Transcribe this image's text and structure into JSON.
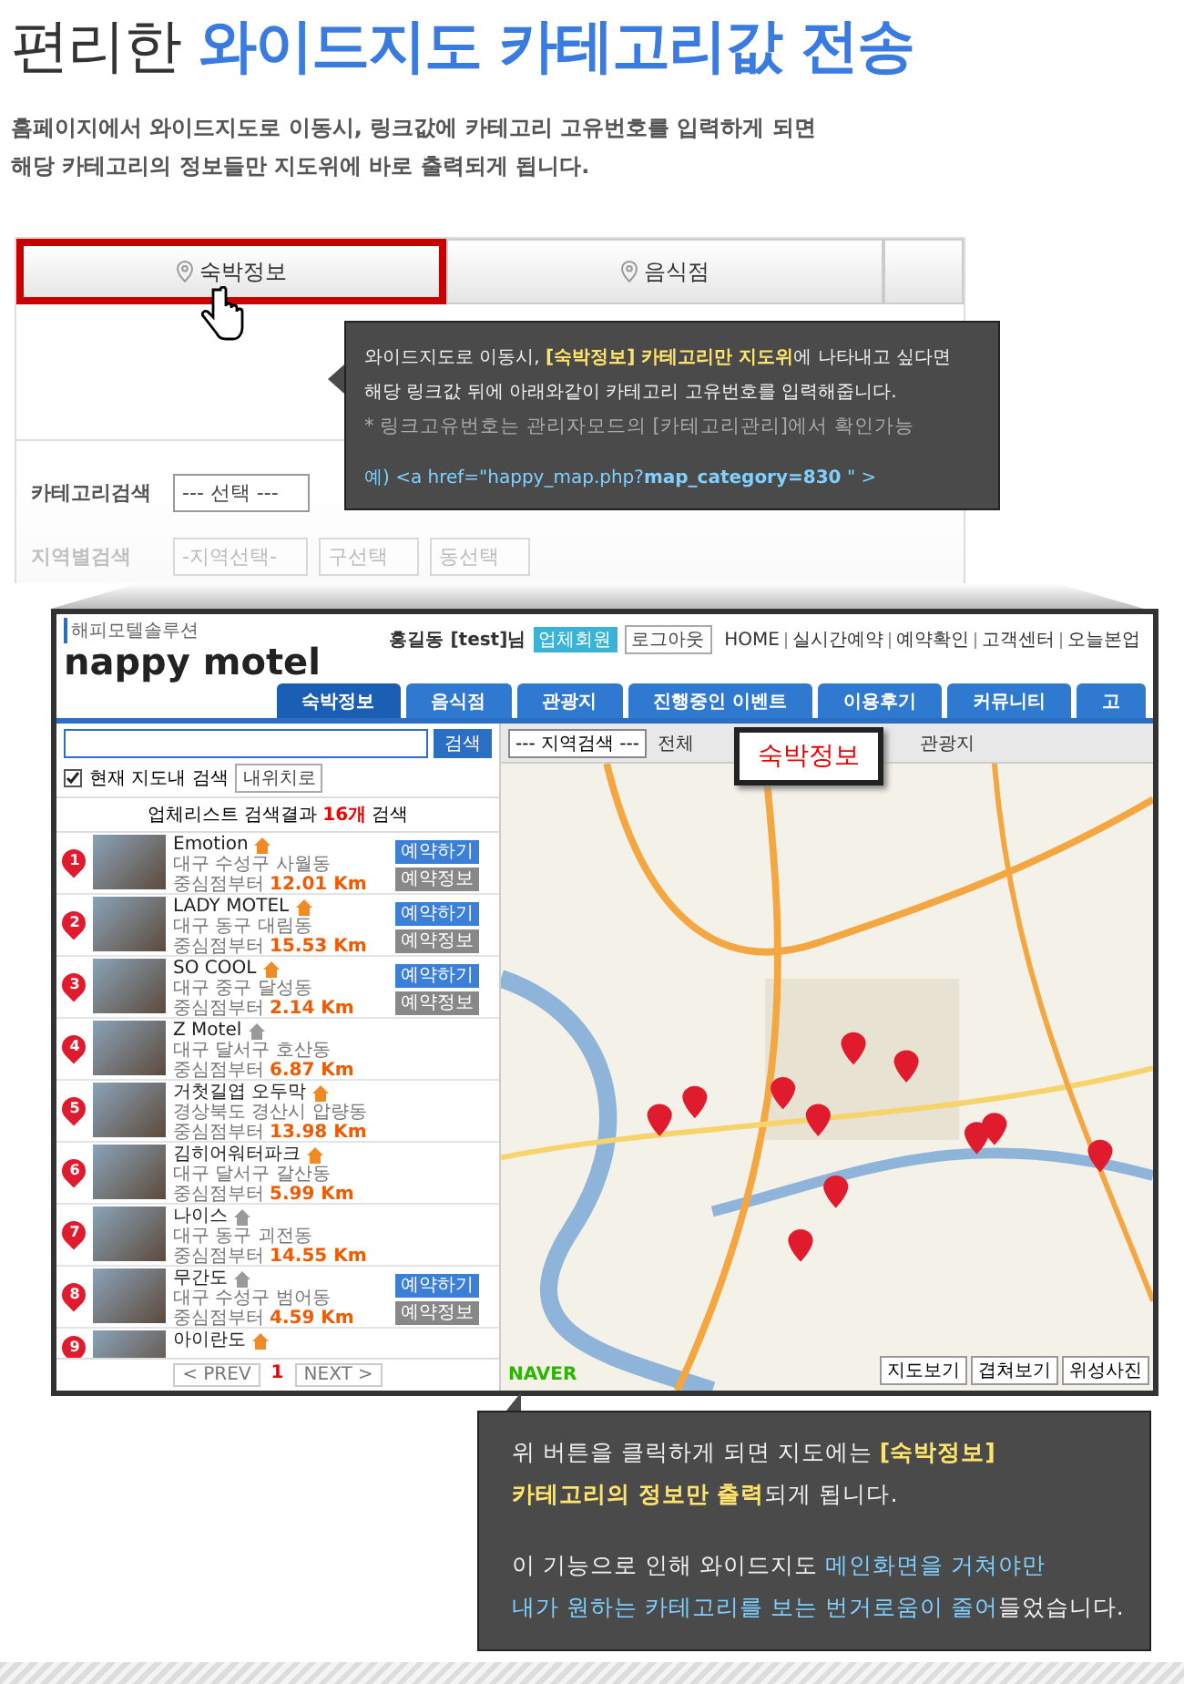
{
  "heading": {
    "plain": "편리한",
    "accent": "와이드지도 카테고리값 전송"
  },
  "intro": [
    "홈페이지에서 와이드지도로 이동시, 링크값에 카테고리 고유번호를 입력하게 되면",
    "해당 카테고리의 정보들만 지도위에 바로 출력되게 됩니다."
  ],
  "demo_panel": {
    "tabs": [
      {
        "label": "숙박정보",
        "selected": true
      },
      {
        "label": "음식점",
        "selected": false
      }
    ],
    "search_rows": [
      {
        "label": "카테고리검색",
        "selects": [
          "--- 선택 ---"
        ]
      },
      {
        "label": "지역별검색",
        "selects": [
          "-지역선택-",
          "구선택",
          "동선택"
        ]
      }
    ]
  },
  "top_callout": {
    "lines": [
      [
        {
          "text": "와이드지도로 이동시, ",
          "kind": "plain"
        },
        {
          "text": "[숙박정보] 카테고리만 지도위",
          "kind": "yellow"
        },
        {
          "text": "에 나타내고 싶다면",
          "kind": "plain"
        }
      ],
      [
        {
          "text": "해당 링크값 뒤에 아래와같이 카테고리 고유번호를 입력해줍니다.",
          "kind": "plain"
        }
      ]
    ],
    "note": "* 링크고유번호는 관리자모드의 [카테고리관리]에서 확인가능",
    "code": [
      {
        "text": "예) <a href=\"happy_map.php?",
        "kind": "cyan"
      },
      {
        "text": "map_category=830",
        "kind": "cyanbold"
      },
      {
        "text": " \" >",
        "kind": "cyan"
      }
    ]
  },
  "screenshot": {
    "logo_caption": "해피모텔솔루션",
    "logo": "nappy motel",
    "user": "홍길동 [test]님",
    "member_badge": "업체회원",
    "logout": "로그아웃",
    "top_links": [
      "HOME",
      "실시간예약",
      "예약확인",
      "고객센터",
      "오늘본업"
    ],
    "nav": [
      {
        "label": "숙박정보",
        "selected": true
      },
      {
        "label": "음식점",
        "selected": false
      },
      {
        "label": "관광지",
        "selected": false
      },
      {
        "label": "진행중인 이벤트",
        "selected": false
      },
      {
        "label": "이용후기",
        "selected": false
      },
      {
        "label": "커뮤니티",
        "selected": false
      },
      {
        "label": "고",
        "selected": false
      }
    ],
    "search_button": "검색",
    "in_map_search": {
      "label": "현재 지도내 검색",
      "checked": true
    },
    "my_location": "내위치로",
    "list_header": {
      "before": "업체리스트 검색결과",
      "count": "16개",
      "after": "검색"
    },
    "listings": [
      {
        "pin": "1",
        "name": "Emotion",
        "color": "#f08a24",
        "address": "대구 수성구 사월동",
        "distance_label": "중심점부터",
        "distance": "12.01 Km",
        "buttons": [
          "예약하기",
          "예약정보"
        ]
      },
      {
        "pin": "2",
        "name": "LADY MOTEL",
        "color": "#f08a24",
        "address": "대구 동구 대림동",
        "distance_label": "중심점부터",
        "distance": "15.53 Km",
        "buttons": [
          "예약하기",
          "예약정보"
        ]
      },
      {
        "pin": "3",
        "name": "SO COOL",
        "color": "#f08a24",
        "address": "대구 중구 달성동",
        "distance_label": "중심점부터",
        "distance": "2.14 Km",
        "buttons": [
          "예약하기",
          "예약정보"
        ]
      },
      {
        "pin": "4",
        "name": "Z Motel",
        "color": "#9a9a9a",
        "address": "대구 달서구 호산동",
        "distance_label": "중심점부터",
        "distance": "6.87 Km"
      },
      {
        "pin": "5",
        "name": "거첫길엽 오두막",
        "color": "#f08a24",
        "address": "경상북도 경산시 압량동",
        "distance_label": "중심점부터",
        "distance": "13.98 Km"
      },
      {
        "pin": "6",
        "name": "김히어워터파크",
        "color": "#f08a24",
        "address": "대구 달서구 갈산동",
        "distance_label": "중심점부터",
        "distance": "5.99 Km"
      },
      {
        "pin": "7",
        "name": "나이스",
        "color": "#9a9a9a",
        "address": "대구 동구 괴전동",
        "distance_label": "중심점부터",
        "distance": "14.55 Km"
      },
      {
        "pin": "8",
        "name": "무간도",
        "color": "#9a9a9a",
        "address": "대구 수성구 범어동",
        "distance_label": "중심점부터",
        "distance": "4.59 Km",
        "buttons": [
          "예약하기",
          "예약정보"
        ]
      },
      {
        "pin": "9",
        "name": "아이란도",
        "color": "#f08a24"
      }
    ],
    "pagination": {
      "prev": "< PREV",
      "page": "1",
      "next": "NEXT >"
    },
    "map_toolbar": {
      "region_select": "--- 지역검색 ---",
      "items": [
        "전체",
        "관광지"
      ],
      "popup": "숙박정보"
    },
    "map_buttons": [
      "지도보기",
      "겹쳐보기",
      "위성사진"
    ],
    "map_credit": "NAVER"
  },
  "bottom_callout": {
    "lines": [
      [
        {
          "text": "위 버튼을 클릭하게 되면 지도에는 ",
          "kind": "plain"
        },
        {
          "text": "[숙박정보]",
          "kind": "yellow"
        }
      ],
      [
        {
          "text": "카테고리의 정보만 출력",
          "kind": "yellow"
        },
        {
          "text": "되게 됩니다.",
          "kind": "plain"
        }
      ],
      [
        {
          "text": "이 기능으로 인해 와이드지도 ",
          "kind": "plain"
        },
        {
          "text": "메인화면을 거쳐야만",
          "kind": "cyan"
        }
      ],
      [
        {
          "text": "내가 원하는 카테고리를 보는 번거로움이 줄어",
          "kind": "cyan"
        },
        {
          "text": "들었습니다.",
          "kind": "plain"
        }
      ]
    ]
  }
}
